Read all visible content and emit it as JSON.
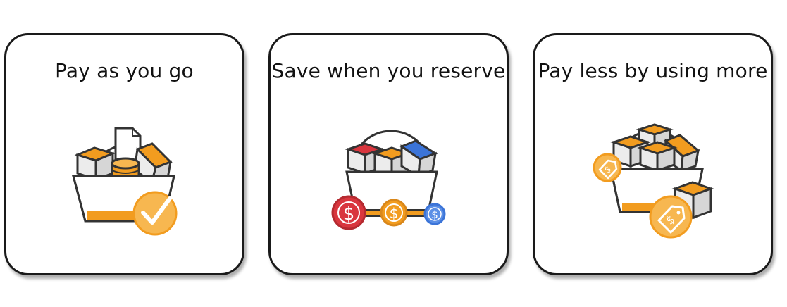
{
  "cards": [
    {
      "title": "Pay as you go"
    },
    {
      "title": "Save when you reserve"
    },
    {
      "title": "Pay less by using more"
    }
  ],
  "colors": {
    "orange": "#f29c1f",
    "orange_light": "#f7b750",
    "red": "#d9363e",
    "blue": "#3b74d8",
    "outline": "#333333",
    "box_gray": "#e3e3e3",
    "card_border": "#1a1a1a"
  },
  "icons": [
    "basket-icon",
    "checkmark-badge-icon",
    "dollar-coin-icon",
    "price-tag-icon",
    "cube-icon",
    "database-icon",
    "document-icon"
  ]
}
